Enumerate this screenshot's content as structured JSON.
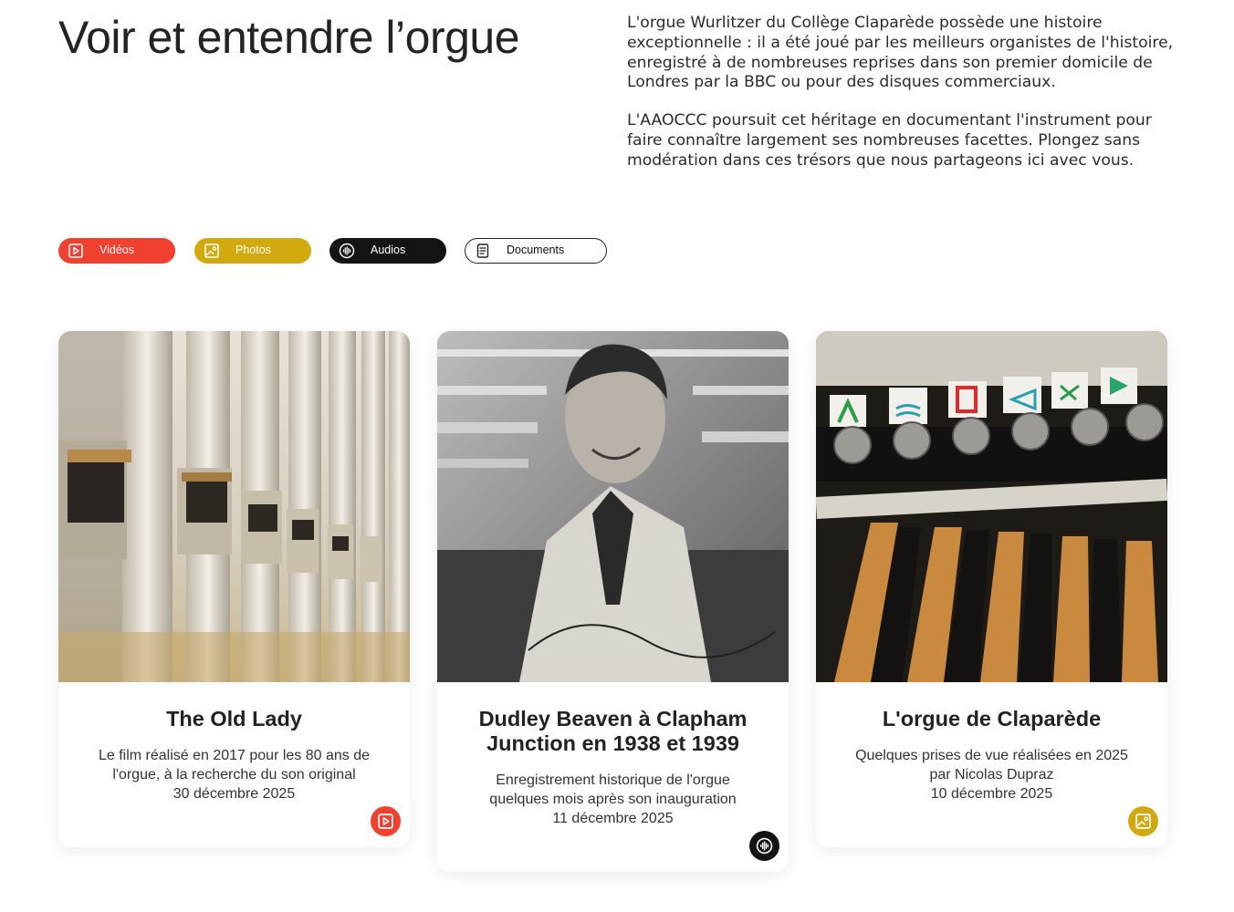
{
  "header": {
    "title": "Voir et entendre l’orgue",
    "intro_p1": "L'orgue Wurlitzer du Collège Claparède possède une histoire exceptionnelle : il a été joué par les meilleurs organistes de l'histoire, enregistré à de nombreuses reprises dans son premier domicile de Londres par la BBC ou pour des disques commerciaux.",
    "intro_p2": "L'AAOCCC poursuit cet héritage en documentant l'instrument pour faire connaître largement ses nombreuses facettes. Plongez sans modération dans ces trésors que nous partageons ici avec vous."
  },
  "filters": [
    {
      "label": "Vidéos",
      "icon": "video-icon",
      "color": "#f0402f"
    },
    {
      "label": "Photos",
      "icon": "photo-icon",
      "color": "#d2aa10"
    },
    {
      "label": "Audios",
      "icon": "audio-icon",
      "color": "#141414"
    },
    {
      "label": "Documents",
      "icon": "document-icon",
      "color": "#ffffff"
    }
  ],
  "cards": [
    {
      "title": "The Old Lady",
      "description": "Le film réalisé en 2017 pour les 80 ans de l'orgue, à la recherche du son original",
      "date": "30 décembre 2025",
      "media_type": "video-icon"
    },
    {
      "title": "Dudley Beaven à Clapham Junction en 1938 et 1939",
      "description": "Enregistrement historique de l'orgue quelques mois après son inauguration",
      "date": "11 décembre 2025",
      "media_type": "audio-icon"
    },
    {
      "title": "L'orgue de Claparède",
      "description": "Quelques prises de vue réalisées en 2025 par Nicolas Dupraz",
      "date": "10 décembre 2025",
      "media_type": "photo-icon"
    }
  ]
}
